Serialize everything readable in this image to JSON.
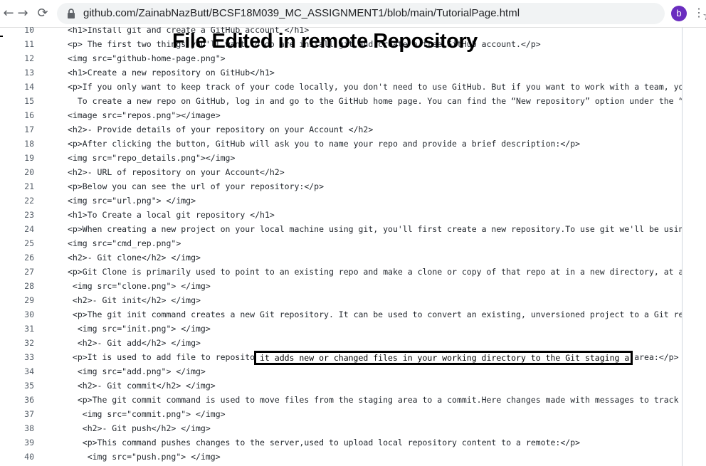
{
  "browser": {
    "url": "github.com/ZainabNazButt/BCSF18M039_MC_ASSIGNMENT1/blob/main/TutorialPage.html",
    "back_icon": "←",
    "forward_icon": "→",
    "reload_icon": "⟳",
    "star_icon": "☆",
    "avatar_letter": "b",
    "menu_icon": "⋮"
  },
  "overlay": {
    "title": "File Edited in remote Repository",
    "highlight_text": "it adds new or changed files in your working directory to the Git staging area:"
  },
  "code_lines": [
    {
      "n": "10",
      "text": "<h1>Install git and create a GitHub account </h1>"
    },
    {
      "n": "11",
      "text": "<p> The first two things you'll want to do are install git and create a free GitHub account.</p>"
    },
    {
      "n": "12",
      "text": "<img src=\"github-home-page.png\">"
    },
    {
      "n": "13",
      "text": "<h1>Create a new repository on GitHub</h1>"
    },
    {
      "n": "14",
      "text": "<p>If you only want to keep track of your code locally, you don't need to use GitHub. But if you want to work with a team, you can"
    },
    {
      "n": "15",
      "text": "  To create a new repo on GitHub, log in and go to the GitHub home page. You can find the “New repository” option under the “+” s"
    },
    {
      "n": "16",
      "text": "<image src=\"repos.png\"></image>"
    },
    {
      "n": "17",
      "text": "<h2>- Provide details of your repository on your Account </h2>"
    },
    {
      "n": "18",
      "text": "<p>After clicking the button, GitHub will ask you to name your repo and provide a brief description:</p>"
    },
    {
      "n": "19",
      "text": "<img src=\"repo_details.png\"></img>"
    },
    {
      "n": "20",
      "text": "<h2>- URL of repository on your Account</h2>"
    },
    {
      "n": "21",
      "text": "<p>Below you can see the url of your repository:</p>"
    },
    {
      "n": "22",
      "text": "<img src=\"url.png\"> </img>"
    },
    {
      "n": "23",
      "text": "<h1>To Create a local git repository </h1>"
    },
    {
      "n": "24",
      "text": "<p>When creating a new project on your local machine using git, you'll first create a new repository.To use git we'll be using the"
    },
    {
      "n": "25",
      "text": "<img src=\"cmd_rep.png\">"
    },
    {
      "n": "26",
      "text": "<h2>- Git clone</h2> </img>"
    },
    {
      "n": "27",
      "text": "<p>Git Clone is primarily used to point to an existing repo and make a clone or copy of that repo at in a new directory, at another"
    },
    {
      "n": "28",
      "text": " <img src=\"clone.png\"> </img>"
    },
    {
      "n": "29",
      "text": " <h2>- Git init</h2> </img>"
    },
    {
      "n": "30",
      "text": " <p>The git init command creates a new Git repository. It can be used to convert an existing, unversioned project to a Git reposito"
    },
    {
      "n": "31",
      "text": "  <img src=\"init.png\"> </img>"
    },
    {
      "n": "32",
      "text": "  <h2>- Git add</h2> </img>"
    },
    {
      "n": "33",
      "text": " <p>It is used to add file to repository,it adds new or changed files in your working directory to the Git staging area:</p>"
    },
    {
      "n": "34",
      "text": "  <img src=\"add.png\"> </img>"
    },
    {
      "n": "35",
      "text": "  <h2>- Git commit</h2> </img>"
    },
    {
      "n": "36",
      "text": "  <p>The git commit command is used to move files from the staging area to a commit.Here changes made with messages to track change"
    },
    {
      "n": "37",
      "text": "   <img src=\"commit.png\"> </img>"
    },
    {
      "n": "38",
      "text": "   <h2>- Git push</h2> </img>"
    },
    {
      "n": "39",
      "text": "   <p>This command pushes changes to the server,used to upload local repository content to a remote:</p>"
    },
    {
      "n": "40",
      "text": "    <img src=\"push.png\"> </img>"
    }
  ]
}
